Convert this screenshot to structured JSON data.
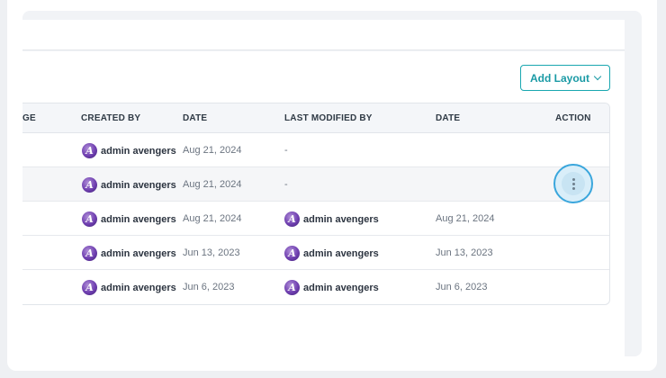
{
  "add_layout_label": "Add Layout",
  "columns": {
    "truncated": "GE",
    "created_by": "CREATED BY",
    "date": "DATE",
    "last_modified_by": "LAST MODIFIED BY",
    "date2": "DATE",
    "action": "ACTION"
  },
  "avatar_letter": "A",
  "rows": [
    {
      "created_by": "admin avengers",
      "created_date": "Aug 21, 2024",
      "modified_by": "-",
      "modified_date": ""
    },
    {
      "created_by": "admin avengers",
      "created_date": "Aug 21, 2024",
      "modified_by": "-",
      "modified_date": ""
    },
    {
      "created_by": "admin avengers",
      "created_date": "Aug 21, 2024",
      "modified_by": "admin avengers",
      "modified_date": "Aug 21, 2024"
    },
    {
      "created_by": "admin avengers",
      "created_date": "Jun 13, 2023",
      "modified_by": "admin avengers",
      "modified_date": "Jun 13, 2023"
    },
    {
      "created_by": "admin avengers",
      "created_date": "Jun 6, 2023",
      "modified_by": "admin avengers",
      "modified_date": "Jun 6, 2023"
    }
  ],
  "colors": {
    "accent": "#1a9aa5",
    "focus_ring": "#3aa6dc",
    "avatar": "#6f3fb0"
  },
  "icons": {
    "add_layout": "chevron-down-icon",
    "action": "more-vertical-icon",
    "avatar": "avengers-logo-icon"
  }
}
